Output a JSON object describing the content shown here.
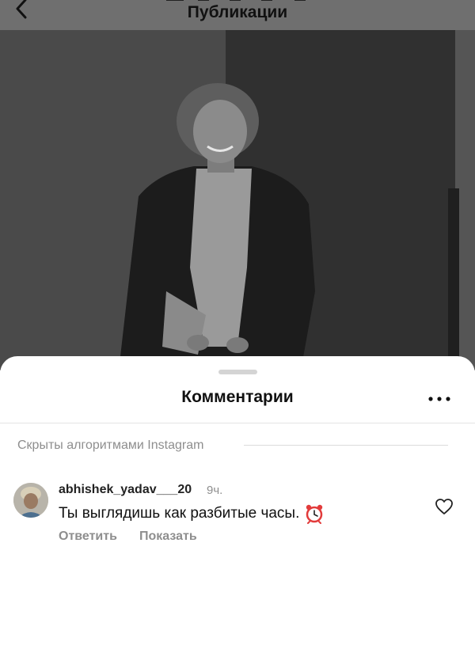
{
  "header": {
    "title": "Публикации",
    "back_icon": "chevron-left-icon"
  },
  "sheet": {
    "title": "Комментарии",
    "more_icon": "more-horizontal-icon",
    "hidden_notice": "Скрыты алгоритмами Instagram"
  },
  "comment": {
    "username": "abhishek_yadav___20",
    "time": "9ч.",
    "text": "Ты выглядишь как разбитые часы.",
    "emoji_icon": "alarm-clock-icon",
    "like_icon": "heart-outline-icon",
    "reply_label": "Ответить",
    "show_label": "Показать"
  },
  "colors": {
    "muted_text": "#8e8e8e",
    "sheet_bg": "#ffffff",
    "overlay_bg": "#6f6f6f"
  }
}
